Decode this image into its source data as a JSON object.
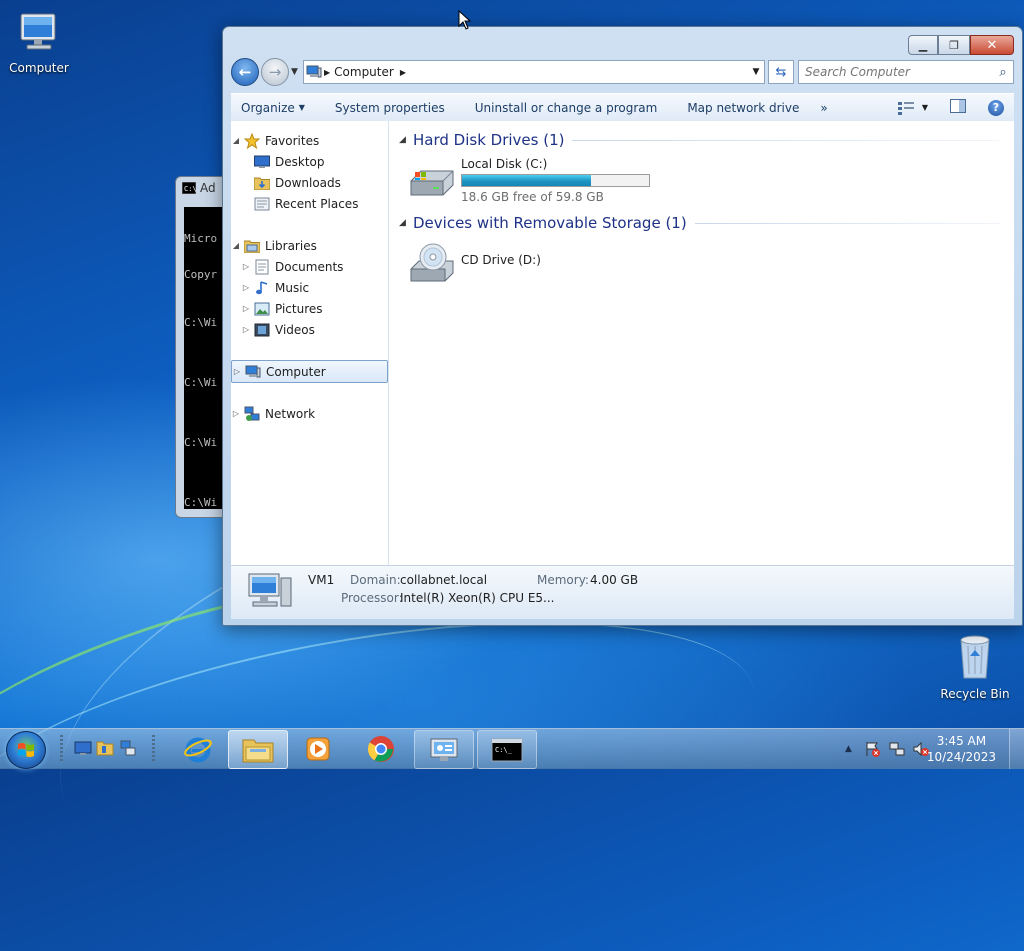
{
  "desktop": {
    "icons": [
      {
        "label": "Computer"
      },
      {
        "label": "Recycle Bin"
      }
    ]
  },
  "cmd_window": {
    "title": "Ad",
    "lines": [
      "Micro",
      "Copyr",
      "C:\\Wi",
      "C:\\Wi",
      "C:\\Wi",
      "C:\\Wi"
    ]
  },
  "explorer": {
    "address": {
      "path": "Computer"
    },
    "search": {
      "placeholder": "Search Computer"
    },
    "toolbar": {
      "organize": "Organize",
      "system_properties": "System properties",
      "uninstall": "Uninstall or change a program",
      "map_network": "Map network drive",
      "more": "»"
    },
    "nav": {
      "favorites": "Favorites",
      "desktop": "Desktop",
      "downloads": "Downloads",
      "recent_places": "Recent Places",
      "libraries": "Libraries",
      "documents": "Documents",
      "music": "Music",
      "pictures": "Pictures",
      "videos": "Videos",
      "computer": "Computer",
      "network": "Network"
    },
    "groups": {
      "hard_disk": "Hard Disk Drives (1)",
      "removable": "Devices with Removable Storage (1)"
    },
    "drives": {
      "c": {
        "name": "Local Disk (C:)",
        "free_text": "18.6 GB free of 59.8 GB",
        "used_fraction": 0.69
      },
      "d": {
        "name": "CD Drive (D:)"
      }
    },
    "details": {
      "name": "VM1",
      "domain_label": "Domain:",
      "domain": "collabnet.local",
      "memory_label": "Memory:",
      "memory": "4.00 GB",
      "processor_label": "Processor:",
      "processor": "Intel(R) Xeon(R) CPU E5..."
    }
  },
  "taskbar": {
    "clock_time": "3:45 AM",
    "clock_date": "10/24/2023"
  },
  "colors": {
    "accent": "#1e3287",
    "drive_bar": "#1e93c2",
    "close_button": "#c94a33"
  }
}
